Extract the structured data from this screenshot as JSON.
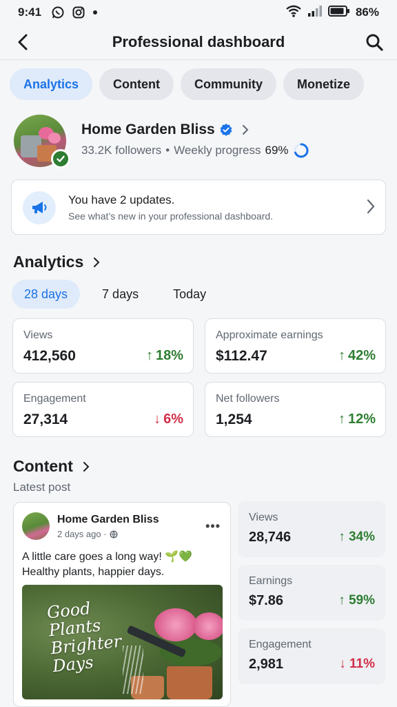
{
  "status_bar": {
    "time": "9:41",
    "battery": "86%"
  },
  "header": {
    "title": "Professional dashboard"
  },
  "tabs": [
    {
      "label": "Analytics",
      "active": true
    },
    {
      "label": "Content",
      "active": false
    },
    {
      "label": "Community",
      "active": false
    },
    {
      "label": "Monetize",
      "active": false
    }
  ],
  "profile": {
    "name": "Home Garden Bliss",
    "followers": "33.2K followers",
    "separator": "•",
    "weekly_label": "Weekly progress",
    "weekly_value": "69%",
    "weekly_fraction": 0.69
  },
  "updates": {
    "title": "You have 2 updates.",
    "subtitle": "See what’s new in your professional dashboard."
  },
  "analytics": {
    "title": "Analytics",
    "ranges": [
      {
        "label": "28 days",
        "active": true
      },
      {
        "label": "7 days",
        "active": false
      },
      {
        "label": "Today",
        "active": false
      }
    ],
    "metrics": [
      {
        "label": "Views",
        "value": "412,560",
        "change": "18%",
        "direction": "up"
      },
      {
        "label": "Approximate earnings",
        "value": "$112.47",
        "change": "42%",
        "direction": "up"
      },
      {
        "label": "Engagement",
        "value": "27,314",
        "change": "6%",
        "direction": "down"
      },
      {
        "label": "Net followers",
        "value": "1,254",
        "change": "12%",
        "direction": "up"
      }
    ]
  },
  "content": {
    "title": "Content",
    "latest_label": "Latest post",
    "post": {
      "author": "Home Garden Bliss",
      "time": "2 days ago ·",
      "more": "•••",
      "caption": "A little care goes a long way! 🌱💚\nHealthy plants, happier days.",
      "image_text": "Good\nPlants\nBrighter\nDays"
    },
    "stats": [
      {
        "label": "Views",
        "value": "28,746",
        "change": "34%",
        "direction": "up"
      },
      {
        "label": "Earnings",
        "value": "$7.86",
        "change": "59%",
        "direction": "up"
      },
      {
        "label": "Engagement",
        "value": "2,981",
        "change": "11%",
        "direction": "down"
      }
    ]
  },
  "colors": {
    "accent": "#1a73e8",
    "up": "#2e7d32",
    "down": "#d32f4a"
  }
}
